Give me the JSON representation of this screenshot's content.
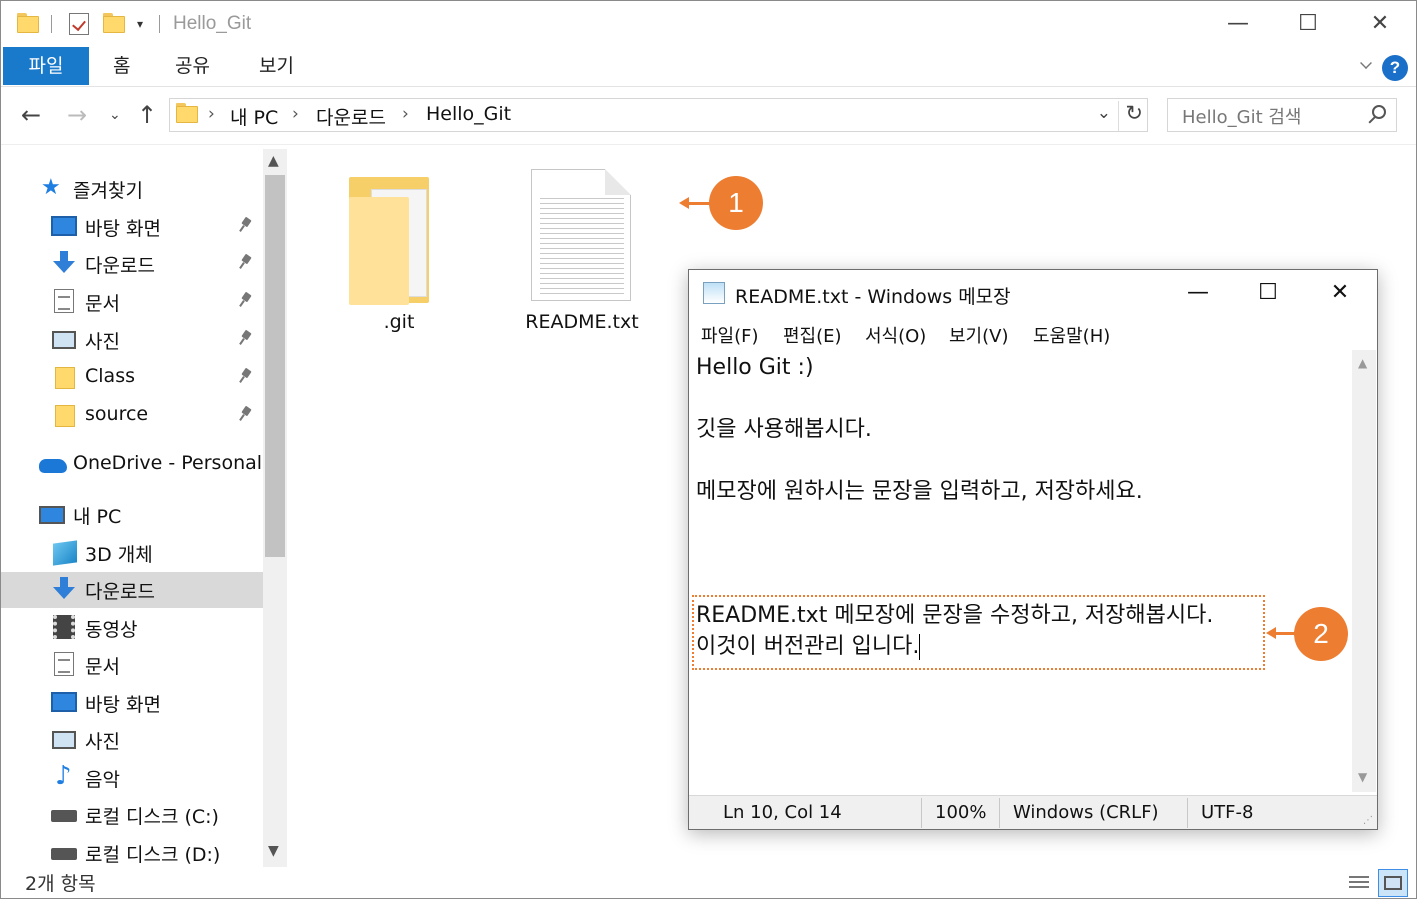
{
  "explorer": {
    "title": "Hello_Git",
    "ribbon_tabs": [
      "파일",
      "홈",
      "공유",
      "보기"
    ],
    "breadcrumb": [
      "내 PC",
      "다운로드",
      "Hello_Git"
    ],
    "search_placeholder": "Hello_Git 검색",
    "sidebar": {
      "quick_access": "즐겨찾기",
      "pinned": [
        "바탕 화면",
        "다운로드",
        "문서",
        "사진",
        "Class",
        "source"
      ],
      "onedrive": "OneDrive - Personal",
      "this_pc": "내 PC",
      "pc_items": [
        "3D 개체",
        "다운로드",
        "동영상",
        "문서",
        "바탕 화면",
        "사진",
        "음악",
        "로컬 디스크 (C:)",
        "로컬 디스크 (D:)"
      ],
      "selected": "다운로드"
    },
    "files": [
      ".git",
      "README.txt"
    ],
    "item_count": "2개 항목"
  },
  "callouts": [
    "1",
    "2"
  ],
  "notepad": {
    "title": "README.txt - Windows 메모장",
    "menu": [
      "파일(F)",
      "편집(E)",
      "서식(O)",
      "보기(V)",
      "도움말(H)"
    ],
    "lines": [
      "Hello Git :)",
      "",
      "깃을 사용해봅시다.",
      "",
      "메모장에 원하시는 문장을 입력하고, 저장하세요.",
      "",
      "",
      "",
      "README.txt 메모장에 문장을 수정하고, 저장해봅시다.",
      "이것이 버전관리 입니다."
    ],
    "status": {
      "position": "Ln 10, Col 14",
      "zoom": "100%",
      "line_ending": "Windows (CRLF)",
      "encoding": "UTF-8"
    }
  },
  "colors": {
    "accent_blue": "#1979ca",
    "callout_orange": "#ed7d31",
    "folder_yellow": "#ffd96b"
  }
}
